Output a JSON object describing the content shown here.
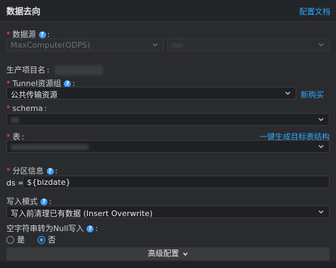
{
  "header": {
    "title": "数据去向",
    "doc_link": "配置文档"
  },
  "datasource": {
    "label": "数据源",
    "type_value": "MaxCompute(ODPS)"
  },
  "project": {
    "label": "生产项目名"
  },
  "tunnel": {
    "label": "Tunnel资源组",
    "value": "公共传输资源",
    "buy_link": "新购买"
  },
  "schema": {
    "label": "schema"
  },
  "table": {
    "label": "表",
    "create_link": "一键生成目标表结构"
  },
  "partition": {
    "label": "分区信息",
    "key": "ds =",
    "value": "${bizdate}"
  },
  "write_mode": {
    "label": "写入模式",
    "value": "写入前清理已有数据 (Insert Overwrite)"
  },
  "null_conv": {
    "label": "空字符串转为Null写入",
    "options": [
      "是",
      "否"
    ],
    "selected": "否"
  },
  "advanced": {
    "label": "高级配置"
  },
  "colors": {
    "accent": "#2ea8ff",
    "required": "#ff4d4f"
  }
}
